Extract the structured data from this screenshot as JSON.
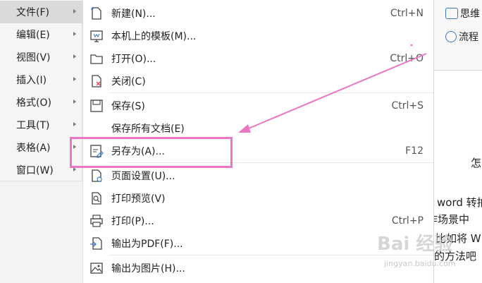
{
  "ribbon": {
    "mindmap_label": "思维",
    "flowchart_label": "流程"
  },
  "document": {
    "lines": [
      "怎",
      "word 转拍",
      "作场景中",
      "比如将 W",
      "的方法吧"
    ]
  },
  "watermark": {
    "logo": "Bai 经验",
    "url": "jingyan.baidu.com"
  },
  "menubar": {
    "items": [
      {
        "label": "文件(F)",
        "active": true
      },
      {
        "label": "编辑(E)"
      },
      {
        "label": "视图(V)"
      },
      {
        "label": "插入(I)"
      },
      {
        "label": "格式(O)"
      },
      {
        "label": "工具(T)"
      },
      {
        "label": "表格(A)"
      },
      {
        "label": "窗口(W)"
      }
    ]
  },
  "file_menu": {
    "items": [
      {
        "icon": "new-document-icon",
        "label": "新建(N)...",
        "shortcut": "Ctrl+N"
      },
      {
        "icon": "template-icon",
        "label": "本机上的模板(M)...",
        "shortcut": ""
      },
      {
        "icon": "open-folder-icon",
        "label": "打开(O)...",
        "shortcut": "Ctrl+O"
      },
      {
        "icon": "close-document-icon",
        "label": "关闭(C)",
        "shortcut": ""
      },
      {
        "icon": "save-icon",
        "label": "保存(S)",
        "shortcut": "Ctrl+S"
      },
      {
        "icon": "",
        "label": "保存所有文档(E)",
        "shortcut": ""
      },
      {
        "icon": "save-as-icon",
        "label": "另存为(A)...",
        "shortcut": "F12"
      },
      {
        "icon": "page-setup-icon",
        "label": "页面设置(U)...",
        "shortcut": ""
      },
      {
        "icon": "print-preview-icon",
        "label": "打印预览(V)",
        "shortcut": ""
      },
      {
        "icon": "printer-icon",
        "label": "打印(P)...",
        "shortcut": "Ctrl+P"
      },
      {
        "icon": "export-pdf-icon",
        "label": "输出为PDF(F)...",
        "shortcut": ""
      },
      {
        "icon": "export-image-icon",
        "label": "输出为图片(H)...",
        "shortcut": ""
      }
    ]
  },
  "colors": {
    "annotation": "#e878c4",
    "menu_active": "#dadada",
    "icon_blue": "#3a78c9"
  }
}
